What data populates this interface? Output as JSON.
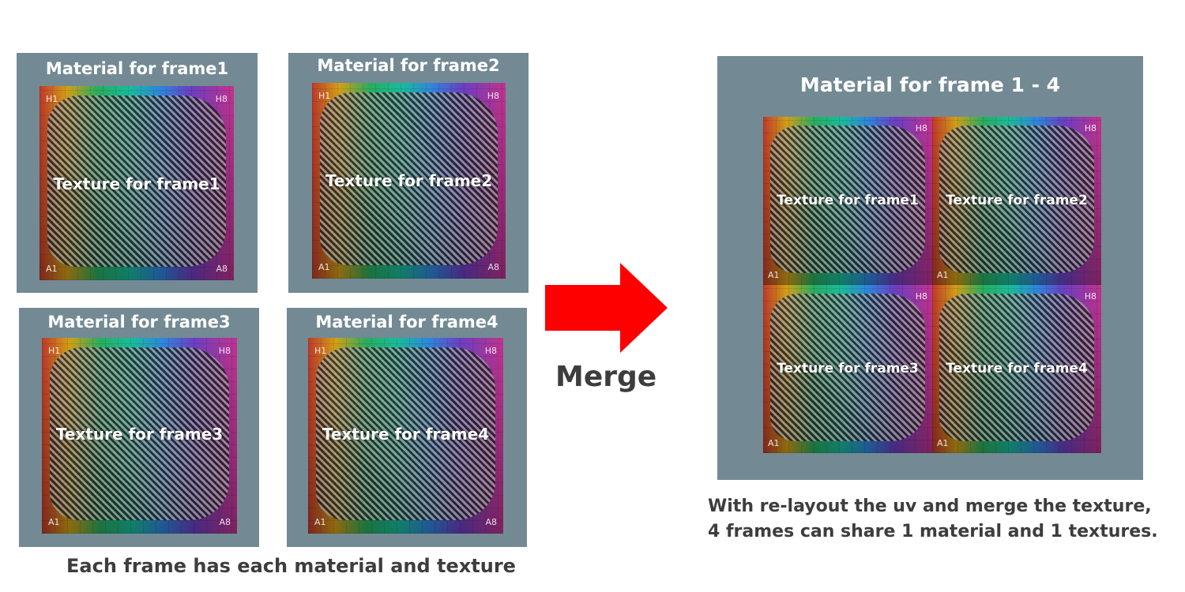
{
  "left_panels": [
    {
      "title": "Material for frame1",
      "texture": "Texture for frame1"
    },
    {
      "title": "Material for frame2",
      "texture": "Texture for frame2"
    },
    {
      "title": "Material for frame3",
      "texture": "Texture for frame3"
    },
    {
      "title": "Material for frame4",
      "texture": "Texture for frame4"
    }
  ],
  "left_caption": "Each frame has each material and texture",
  "merge_label": "Merge",
  "arrow_color": "#ff0000",
  "right_panel": {
    "title": "Material for frame 1 - 4",
    "textures": [
      "Texture for frame1",
      "Texture for frame2",
      "Texture for frame3",
      "Texture for frame4"
    ]
  },
  "right_caption": [
    "With re-layout the uv and merge the texture,",
    "4 frames can share 1 material and 1 textures."
  ],
  "grid_labels": {
    "top_left": "H1",
    "top_right": "H8",
    "bottom_left": "A1",
    "bottom_right": "A8"
  },
  "colors": {
    "panel": "#738a94",
    "caption": "#3d3d3d"
  }
}
